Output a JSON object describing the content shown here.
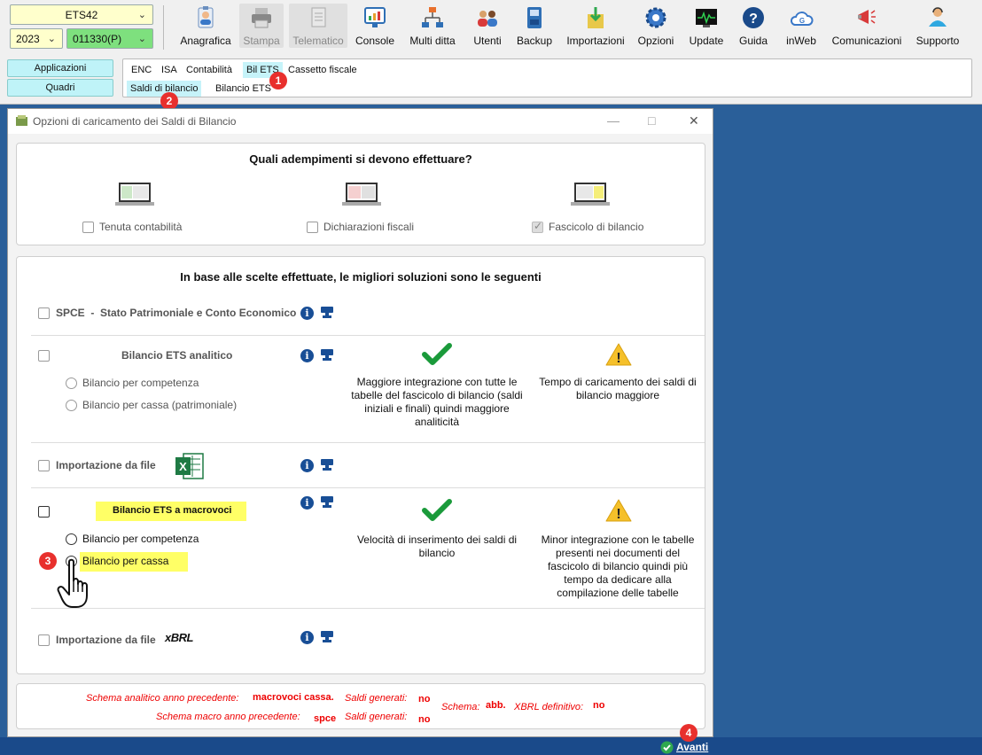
{
  "header": {
    "product_select": "ETS42",
    "year_select": "2023",
    "company_select": "011330(P)"
  },
  "toolbar": [
    {
      "id": "anagrafica",
      "label": "Anagrafica",
      "icon": "person-card-icon",
      "enabled": true
    },
    {
      "id": "stampa",
      "label": "Stampa",
      "icon": "printer-icon",
      "enabled": false
    },
    {
      "id": "telematico",
      "label": "Telematico",
      "icon": "document-icon",
      "enabled": false
    },
    {
      "id": "console",
      "label": "Console",
      "icon": "monitor-chart-icon",
      "enabled": true
    },
    {
      "id": "multiditta",
      "label": "Multi ditta",
      "icon": "org-chart-icon",
      "enabled": true
    },
    {
      "id": "utenti",
      "label": "Utenti",
      "icon": "users-icon",
      "enabled": true
    },
    {
      "id": "backup",
      "label": "Backup",
      "icon": "save-icon",
      "enabled": true
    },
    {
      "id": "importazioni",
      "label": "Importazioni",
      "icon": "import-icon",
      "enabled": true
    },
    {
      "id": "opzioni",
      "label": "Opzioni",
      "icon": "gear-icon",
      "enabled": true
    },
    {
      "id": "update",
      "label": "Update",
      "icon": "pulse-monitor-icon",
      "enabled": true
    },
    {
      "id": "guida",
      "label": "Guida",
      "icon": "question-icon",
      "enabled": true
    },
    {
      "id": "inweb",
      "label": "inWeb",
      "icon": "cloud-icon",
      "enabled": true
    },
    {
      "id": "comunicazioni",
      "label": "Comunicazioni",
      "icon": "megaphone-icon",
      "enabled": true
    },
    {
      "id": "supporto",
      "label": "Supporto",
      "icon": "support-person-icon",
      "enabled": true
    }
  ],
  "nav": {
    "applicazioni": "Applicazioni",
    "quadri": "Quadri"
  },
  "menu": {
    "row1": [
      "ENC",
      "ISA",
      "Contabilità",
      "Bil ETS",
      "Cassetto fiscale"
    ],
    "row2": [
      "Saldi di bilancio",
      "Bilancio ETS"
    ]
  },
  "badges": [
    "1",
    "2",
    "3",
    "4"
  ],
  "dialog": {
    "title": "Opzioni di caricamento dei Saldi di Bilancio",
    "q_title": "Quali adempimenti si devono effettuare?",
    "adempimenti": [
      {
        "label": "Tenuta contabilità",
        "checked": false
      },
      {
        "label": "Dichiarazioni fiscali",
        "checked": false
      },
      {
        "label": "Fascicolo di bilancio",
        "checked": true
      }
    ],
    "sol_title": "In base alle scelte effettuate, le migliori soluzioni sono le seguenti",
    "spce": "SPCE  -  Stato Patrimoniale e Conto Economico",
    "ets_analitico": {
      "title": "Bilancio ETS analitico",
      "radio1": "Bilancio per competenza",
      "radio2": "Bilancio per cassa (patrimoniale)",
      "pro": "Maggiore integrazione con tutte le tabelle del fascicolo di bilancio (saldi iniziali e finali) quindi maggiore analiticità",
      "con": "Tempo di caricamento dei saldi di bilancio maggiore"
    },
    "import_file": "Importazione da file",
    "ets_macro": {
      "title": "Bilancio ETS a macrovoci",
      "radio1": "Bilancio per competenza",
      "radio2": "Bilancio per cassa",
      "pro": "Velocità di inserimento dei saldi di bilancio",
      "con": "Minor integrazione con le tabelle presenti nei documenti del fascicolo di bilancio quindi più tempo da dedicare alla compilazione delle tabelle"
    },
    "import_file2": "Importazione da file",
    "xbrl_logo": "xBRL",
    "info_glyph": "i",
    "warning_glyph": "!",
    "check_glyph": "✔",
    "footer": {
      "schema_analitico_label": "Schema analitico anno precedente:",
      "schema_analitico_value": "macrovoci cassa.",
      "saldi1_label": "Saldi generati:",
      "saldi1_value": "no",
      "schema_macro_label": "Schema macro anno precedente:",
      "schema_macro_value": "spce",
      "saldi2_label": "Saldi generati:",
      "saldi2_value": "no",
      "schema_label": "Schema:",
      "schema_value": "abb.",
      "xbrl_label": "XBRL definitivo:",
      "xbrl_value": "no"
    },
    "next_label": "Avanti"
  },
  "colors": {
    "accent_cyan": "#bff3f8",
    "highlight_yellow": "#ffff66",
    "badge_red": "#e8302d",
    "check_green": "#1a9a3a",
    "warning_yellow": "#f5c02a",
    "desktop_blue": "#2a5f99"
  }
}
